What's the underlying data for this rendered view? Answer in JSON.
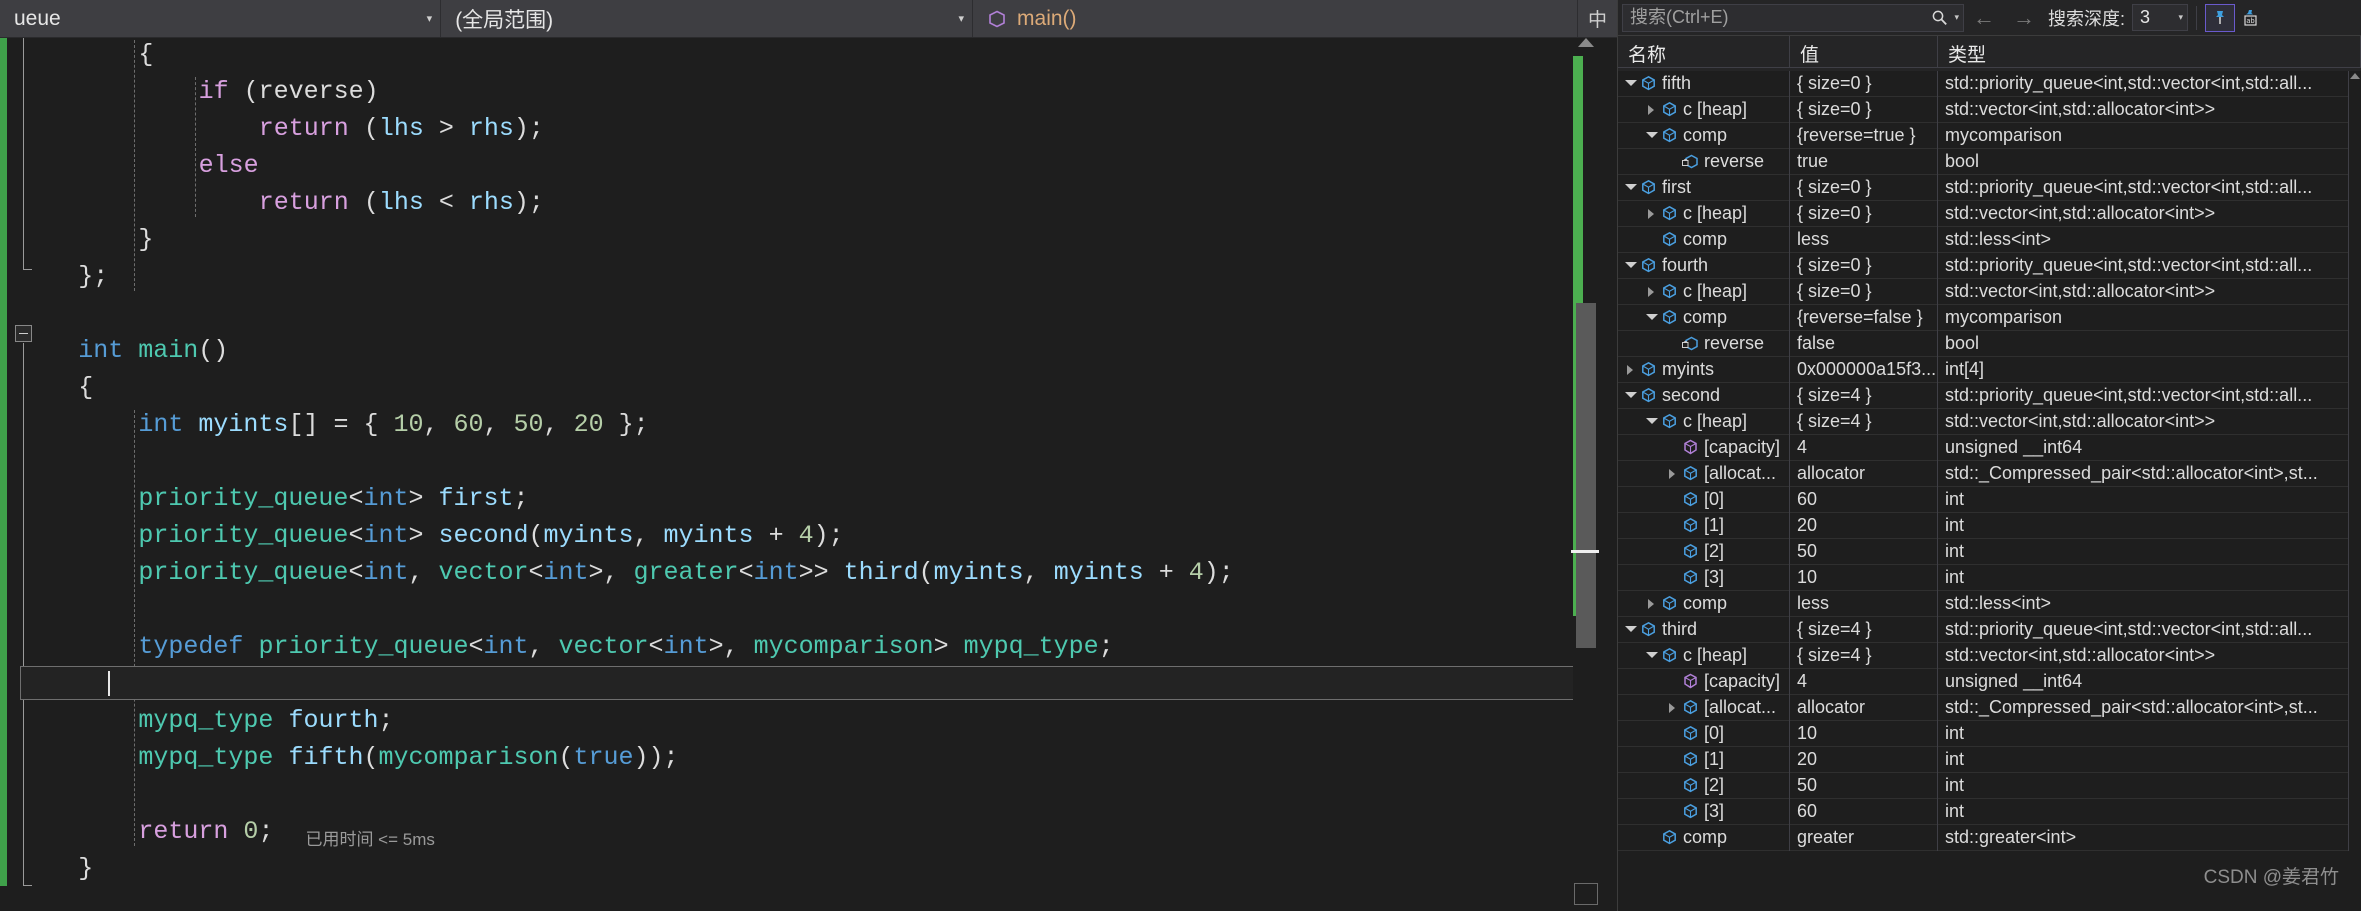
{
  "nav_bar": {
    "scope_combo": {
      "text": "ueue",
      "caret": "▾"
    },
    "range_combo": {
      "text": "(全局范围)",
      "caret": "▾"
    },
    "member_combo": {
      "text": "main()",
      "icon": "cube-icon"
    },
    "ime_indicator": "中"
  },
  "editor": {
    "elapsed_annotation": "已用时间 <= 5ms",
    "lines": [
      {
        "indent": 8,
        "tokens": [
          {
            "t": "{",
            "c": "t-punct"
          }
        ]
      },
      {
        "indent": 12,
        "tokens": [
          {
            "t": "if",
            "c": "t-kw"
          },
          {
            "t": " (",
            "c": "t-punct"
          },
          {
            "t": "reverse",
            "c": "t-plain"
          },
          {
            "t": ")",
            "c": "t-punct"
          }
        ]
      },
      {
        "indent": 16,
        "tokens": [
          {
            "t": "return",
            "c": "t-kw"
          },
          {
            "t": " (",
            "c": "t-punct"
          },
          {
            "t": "lhs",
            "c": "t-var"
          },
          {
            "t": " > ",
            "c": "t-punct"
          },
          {
            "t": "rhs",
            "c": "t-var"
          },
          {
            "t": ");",
            "c": "t-punct"
          }
        ]
      },
      {
        "indent": 12,
        "tokens": [
          {
            "t": "else",
            "c": "t-kw"
          }
        ]
      },
      {
        "indent": 16,
        "tokens": [
          {
            "t": "return",
            "c": "t-kw"
          },
          {
            "t": " (",
            "c": "t-punct"
          },
          {
            "t": "lhs",
            "c": "t-var"
          },
          {
            "t": " < ",
            "c": "t-punct"
          },
          {
            "t": "rhs",
            "c": "t-var"
          },
          {
            "t": ");",
            "c": "t-punct"
          }
        ]
      },
      {
        "indent": 8,
        "tokens": [
          {
            "t": "}",
            "c": "t-punct"
          }
        ]
      },
      {
        "indent": 4,
        "tokens": [
          {
            "t": "};",
            "c": "t-punct"
          }
        ]
      },
      {
        "indent": 0,
        "tokens": []
      },
      {
        "indent": 4,
        "tokens": [
          {
            "t": "int",
            "c": "t-type"
          },
          {
            "t": " ",
            "c": "t-punct"
          },
          {
            "t": "main",
            "c": "t-fn"
          },
          {
            "t": "()",
            "c": "t-punct"
          }
        ]
      },
      {
        "indent": 4,
        "tokens": [
          {
            "t": "{",
            "c": "t-punct"
          }
        ]
      },
      {
        "indent": 8,
        "tokens": [
          {
            "t": "int",
            "c": "t-type"
          },
          {
            "t": " ",
            "c": "t-punct"
          },
          {
            "t": "myints",
            "c": "t-var"
          },
          {
            "t": "[] = { ",
            "c": "t-punct"
          },
          {
            "t": "10",
            "c": "t-num"
          },
          {
            "t": ", ",
            "c": "t-punct"
          },
          {
            "t": "60",
            "c": "t-num"
          },
          {
            "t": ", ",
            "c": "t-punct"
          },
          {
            "t": "50",
            "c": "t-num"
          },
          {
            "t": ", ",
            "c": "t-punct"
          },
          {
            "t": "20",
            "c": "t-num"
          },
          {
            "t": " };",
            "c": "t-punct"
          }
        ]
      },
      {
        "indent": 0,
        "tokens": []
      },
      {
        "indent": 8,
        "tokens": [
          {
            "t": "priority_queue",
            "c": "t-tmpl"
          },
          {
            "t": "<",
            "c": "t-punct"
          },
          {
            "t": "int",
            "c": "t-type"
          },
          {
            "t": "> ",
            "c": "t-punct"
          },
          {
            "t": "first",
            "c": "t-var"
          },
          {
            "t": ";",
            "c": "t-punct"
          }
        ]
      },
      {
        "indent": 8,
        "tokens": [
          {
            "t": "priority_queue",
            "c": "t-tmpl"
          },
          {
            "t": "<",
            "c": "t-punct"
          },
          {
            "t": "int",
            "c": "t-type"
          },
          {
            "t": "> ",
            "c": "t-punct"
          },
          {
            "t": "second",
            "c": "t-var"
          },
          {
            "t": "(",
            "c": "t-punct"
          },
          {
            "t": "myints",
            "c": "t-var"
          },
          {
            "t": ", ",
            "c": "t-punct"
          },
          {
            "t": "myints",
            "c": "t-var"
          },
          {
            "t": " + ",
            "c": "t-punct"
          },
          {
            "t": "4",
            "c": "t-num"
          },
          {
            "t": ");",
            "c": "t-punct"
          }
        ]
      },
      {
        "indent": 8,
        "tokens": [
          {
            "t": "priority_queue",
            "c": "t-tmpl"
          },
          {
            "t": "<",
            "c": "t-punct"
          },
          {
            "t": "int",
            "c": "t-type"
          },
          {
            "t": ", ",
            "c": "t-punct"
          },
          {
            "t": "vector",
            "c": "t-tmpl"
          },
          {
            "t": "<",
            "c": "t-punct"
          },
          {
            "t": "int",
            "c": "t-type"
          },
          {
            "t": ">, ",
            "c": "t-punct"
          },
          {
            "t": "greater",
            "c": "t-tmpl"
          },
          {
            "t": "<",
            "c": "t-punct"
          },
          {
            "t": "int",
            "c": "t-type"
          },
          {
            "t": ">> ",
            "c": "t-punct"
          },
          {
            "t": "third",
            "c": "t-var"
          },
          {
            "t": "(",
            "c": "t-punct"
          },
          {
            "t": "myints",
            "c": "t-var"
          },
          {
            "t": ", ",
            "c": "t-punct"
          },
          {
            "t": "myints",
            "c": "t-var"
          },
          {
            "t": " + ",
            "c": "t-punct"
          },
          {
            "t": "4",
            "c": "t-num"
          },
          {
            "t": ");",
            "c": "t-punct"
          }
        ]
      },
      {
        "indent": 0,
        "tokens": []
      },
      {
        "indent": 8,
        "tokens": [
          {
            "t": "typedef",
            "c": "t-typedef"
          },
          {
            "t": " ",
            "c": "t-punct"
          },
          {
            "t": "priority_queue",
            "c": "t-tmpl"
          },
          {
            "t": "<",
            "c": "t-punct"
          },
          {
            "t": "int",
            "c": "t-type"
          },
          {
            "t": ", ",
            "c": "t-punct"
          },
          {
            "t": "vector",
            "c": "t-tmpl"
          },
          {
            "t": "<",
            "c": "t-punct"
          },
          {
            "t": "int",
            "c": "t-type"
          },
          {
            "t": ">, ",
            "c": "t-punct"
          },
          {
            "t": "mycomparison",
            "c": "t-tmpl"
          },
          {
            "t": "> ",
            "c": "t-punct"
          },
          {
            "t": "mypq_type",
            "c": "t-tmpl"
          },
          {
            "t": ";",
            "c": "t-punct"
          }
        ]
      },
      {
        "indent": 0,
        "tokens": []
      },
      {
        "indent": 8,
        "tokens": [
          {
            "t": "mypq_type",
            "c": "t-tmpl"
          },
          {
            "t": " ",
            "c": "t-punct"
          },
          {
            "t": "fourth",
            "c": "t-var"
          },
          {
            "t": ";",
            "c": "t-punct"
          }
        ]
      },
      {
        "indent": 8,
        "tokens": [
          {
            "t": "mypq_type",
            "c": "t-tmpl"
          },
          {
            "t": " ",
            "c": "t-punct"
          },
          {
            "t": "fifth",
            "c": "t-var"
          },
          {
            "t": "(",
            "c": "t-punct"
          },
          {
            "t": "mycomparison",
            "c": "t-tmpl"
          },
          {
            "t": "(",
            "c": "t-punct"
          },
          {
            "t": "true",
            "c": "t-bool"
          },
          {
            "t": "));",
            "c": "t-punct"
          }
        ]
      },
      {
        "indent": 0,
        "tokens": []
      },
      {
        "indent": 8,
        "tokens": [
          {
            "t": "return",
            "c": "t-kw"
          },
          {
            "t": " ",
            "c": "t-punct"
          },
          {
            "t": "0",
            "c": "t-num"
          },
          {
            "t": ";",
            "c": "t-punct"
          }
        ]
      },
      {
        "indent": 4,
        "tokens": [
          {
            "t": "}",
            "c": "t-punct"
          }
        ]
      }
    ]
  },
  "watch": {
    "search": {
      "placeholder": "搜索(Ctrl+E)",
      "value": "",
      "icon": "search-icon",
      "caret": "▾"
    },
    "nav_back_icon": "arrow-left-icon",
    "nav_forward_icon": "arrow-right-icon",
    "depth_label": "搜索深度:",
    "depth_value": "3",
    "depth_caret": "▾",
    "pin_button_icon": "pin-icon",
    "hex_button_icon": "ab-display-icon",
    "columns": [
      "名称",
      "值",
      "类型"
    ],
    "rows": [
      {
        "depth": 0,
        "state": "expanded",
        "icon": "var",
        "name": "fifth",
        "value": "{ size=0 }",
        "type": "std::priority_queue<int,std::vector<int,std::all..."
      },
      {
        "depth": 1,
        "state": "collapsed",
        "icon": "var",
        "name": "c [heap]",
        "value": "{ size=0 }",
        "type": "std::vector<int,std::allocator<int>>"
      },
      {
        "depth": 1,
        "state": "expanded",
        "icon": "var",
        "name": "comp",
        "value": "{reverse=true }",
        "type": "mycomparison"
      },
      {
        "depth": 2,
        "state": "none",
        "icon": "priv",
        "name": "reverse",
        "value": "true",
        "type": "bool"
      },
      {
        "depth": 0,
        "state": "expanded",
        "icon": "var",
        "name": "first",
        "value": "{ size=0 }",
        "type": "std::priority_queue<int,std::vector<int,std::all..."
      },
      {
        "depth": 1,
        "state": "collapsed",
        "icon": "var",
        "name": "c [heap]",
        "value": "{ size=0 }",
        "type": "std::vector<int,std::allocator<int>>"
      },
      {
        "depth": 1,
        "state": "none",
        "icon": "var",
        "name": "comp",
        "value": "less",
        "type": "std::less<int>"
      },
      {
        "depth": 0,
        "state": "expanded",
        "icon": "var",
        "name": "fourth",
        "value": "{ size=0 }",
        "type": "std::priority_queue<int,std::vector<int,std::all..."
      },
      {
        "depth": 1,
        "state": "collapsed",
        "icon": "var",
        "name": "c [heap]",
        "value": "{ size=0 }",
        "type": "std::vector<int,std::allocator<int>>"
      },
      {
        "depth": 1,
        "state": "expanded",
        "icon": "var",
        "name": "comp",
        "value": "{reverse=false }",
        "type": "mycomparison"
      },
      {
        "depth": 2,
        "state": "none",
        "icon": "priv",
        "name": "reverse",
        "value": "false",
        "type": "bool"
      },
      {
        "depth": 0,
        "state": "collapsed",
        "icon": "var",
        "name": "myints",
        "value": "0x000000a15f3...",
        "type": "int[4]"
      },
      {
        "depth": 0,
        "state": "expanded",
        "icon": "var",
        "name": "second",
        "value": "{ size=4 }",
        "type": "std::priority_queue<int,std::vector<int,std::all..."
      },
      {
        "depth": 1,
        "state": "expanded",
        "icon": "var",
        "name": "c [heap]",
        "value": "{ size=4 }",
        "type": "std::vector<int,std::allocator<int>>"
      },
      {
        "depth": 2,
        "state": "none",
        "icon": "prop",
        "name": "[capacity]",
        "value": "4",
        "type": "unsigned __int64"
      },
      {
        "depth": 2,
        "state": "collapsed",
        "icon": "var",
        "name": "[allocat...",
        "value": "allocator",
        "type": "std::_Compressed_pair<std::allocator<int>,st..."
      },
      {
        "depth": 2,
        "state": "none",
        "icon": "var",
        "name": "[0]",
        "value": "60",
        "type": "int"
      },
      {
        "depth": 2,
        "state": "none",
        "icon": "var",
        "name": "[1]",
        "value": "20",
        "type": "int"
      },
      {
        "depth": 2,
        "state": "none",
        "icon": "var",
        "name": "[2]",
        "value": "50",
        "type": "int"
      },
      {
        "depth": 2,
        "state": "none",
        "icon": "var",
        "name": "[3]",
        "value": "10",
        "type": "int"
      },
      {
        "depth": 1,
        "state": "collapsed",
        "icon": "var",
        "name": "comp",
        "value": "less",
        "type": "std::less<int>"
      },
      {
        "depth": 0,
        "state": "expanded",
        "icon": "var",
        "name": "third",
        "value": "{ size=4 }",
        "type": "std::priority_queue<int,std::vector<int,std::all..."
      },
      {
        "depth": 1,
        "state": "expanded",
        "icon": "var",
        "name": "c [heap]",
        "value": "{ size=4 }",
        "type": "std::vector<int,std::allocator<int>>"
      },
      {
        "depth": 2,
        "state": "none",
        "icon": "prop",
        "name": "[capacity]",
        "value": "4",
        "type": "unsigned __int64"
      },
      {
        "depth": 2,
        "state": "collapsed",
        "icon": "var",
        "name": "[allocat...",
        "value": "allocator",
        "type": "std::_Compressed_pair<std::allocator<int>,st..."
      },
      {
        "depth": 2,
        "state": "none",
        "icon": "var",
        "name": "[0]",
        "value": "10",
        "type": "int"
      },
      {
        "depth": 2,
        "state": "none",
        "icon": "var",
        "name": "[1]",
        "value": "20",
        "type": "int"
      },
      {
        "depth": 2,
        "state": "none",
        "icon": "var",
        "name": "[2]",
        "value": "50",
        "type": "int"
      },
      {
        "depth": 2,
        "state": "none",
        "icon": "var",
        "name": "[3]",
        "value": "60",
        "type": "int"
      },
      {
        "depth": 1,
        "state": "none",
        "icon": "var",
        "name": "comp",
        "value": "greater",
        "type": "std::greater<int>"
      }
    ]
  },
  "watermark": "CSDN @姜君竹",
  "colors": {
    "editor_bg": "#1e1e1e",
    "navbar_bg": "#3e3e42",
    "change_bar": "#3fa14a",
    "accent_pin": "#6a5acd",
    "var_icon": "#4a9fe0",
    "prop_icon": "#b180d7"
  }
}
